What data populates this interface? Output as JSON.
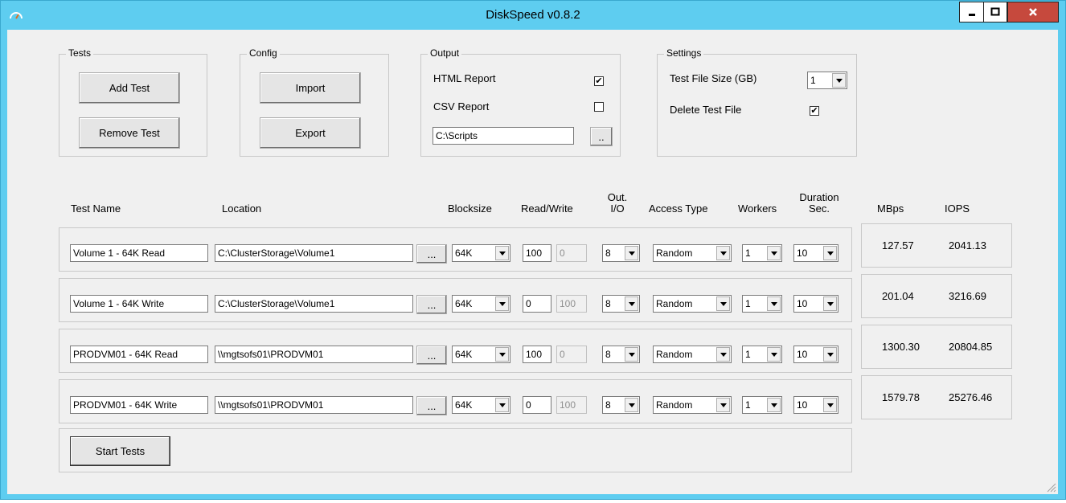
{
  "window": {
    "title": "DiskSpeed v0.8.2"
  },
  "tests_group": {
    "label": "Tests",
    "add_label": "Add Test",
    "remove_label": "Remove Test"
  },
  "config_group": {
    "label": "Config",
    "import_label": "Import",
    "export_label": "Export"
  },
  "output_group": {
    "label": "Output",
    "html_label": "HTML Report",
    "html_checked": true,
    "csv_label": "CSV Report",
    "csv_checked": false,
    "path": "C:\\Scripts",
    "browse_label": ".."
  },
  "settings_group": {
    "label": "Settings",
    "size_label": "Test File Size (GB)",
    "size_value": "1",
    "delete_label": "Delete Test File",
    "delete_checked": true
  },
  "columns": {
    "test_name": "Test Name",
    "location": "Location",
    "blocksize": "Blocksize",
    "read_write": "Read/Write",
    "out_io_1": "Out.",
    "out_io_2": "I/O",
    "access_type": "Access Type",
    "workers": "Workers",
    "duration_1": "Duration",
    "duration_2": "Sec.",
    "mbps": "MBps",
    "iops": "IOPS"
  },
  "browse_label": "...",
  "rows": [
    {
      "name": "Volume 1 - 64K Read",
      "location": "C:\\ClusterStorage\\Volume1",
      "blocksize": "64K",
      "read": "100",
      "write": "0",
      "outio": "8",
      "access": "Random",
      "workers": "1",
      "duration": "10",
      "mbps": "127.57",
      "iops": "2041.13"
    },
    {
      "name": "Volume 1 - 64K Write",
      "location": "C:\\ClusterStorage\\Volume1",
      "blocksize": "64K",
      "read": "0",
      "write": "100",
      "outio": "8",
      "access": "Random",
      "workers": "1",
      "duration": "10",
      "mbps": "201.04",
      "iops": "3216.69"
    },
    {
      "name": "PRODVM01 - 64K Read",
      "location": "\\\\mgtsofs01\\PRODVM01",
      "blocksize": "64K",
      "read": "100",
      "write": "0",
      "outio": "8",
      "access": "Random",
      "workers": "1",
      "duration": "10",
      "mbps": "1300.30",
      "iops": "20804.85"
    },
    {
      "name": "PRODVM01 - 64K Write",
      "location": "\\\\mgtsofs01\\PRODVM01",
      "blocksize": "64K",
      "read": "0",
      "write": "100",
      "outio": "8",
      "access": "Random",
      "workers": "1",
      "duration": "10",
      "mbps": "1579.78",
      "iops": "25276.46"
    }
  ],
  "start_label": "Start Tests",
  "colors": {
    "titlebar": "#5ecdf0",
    "close": "#c6493d",
    "background": "#f0f0f0"
  }
}
